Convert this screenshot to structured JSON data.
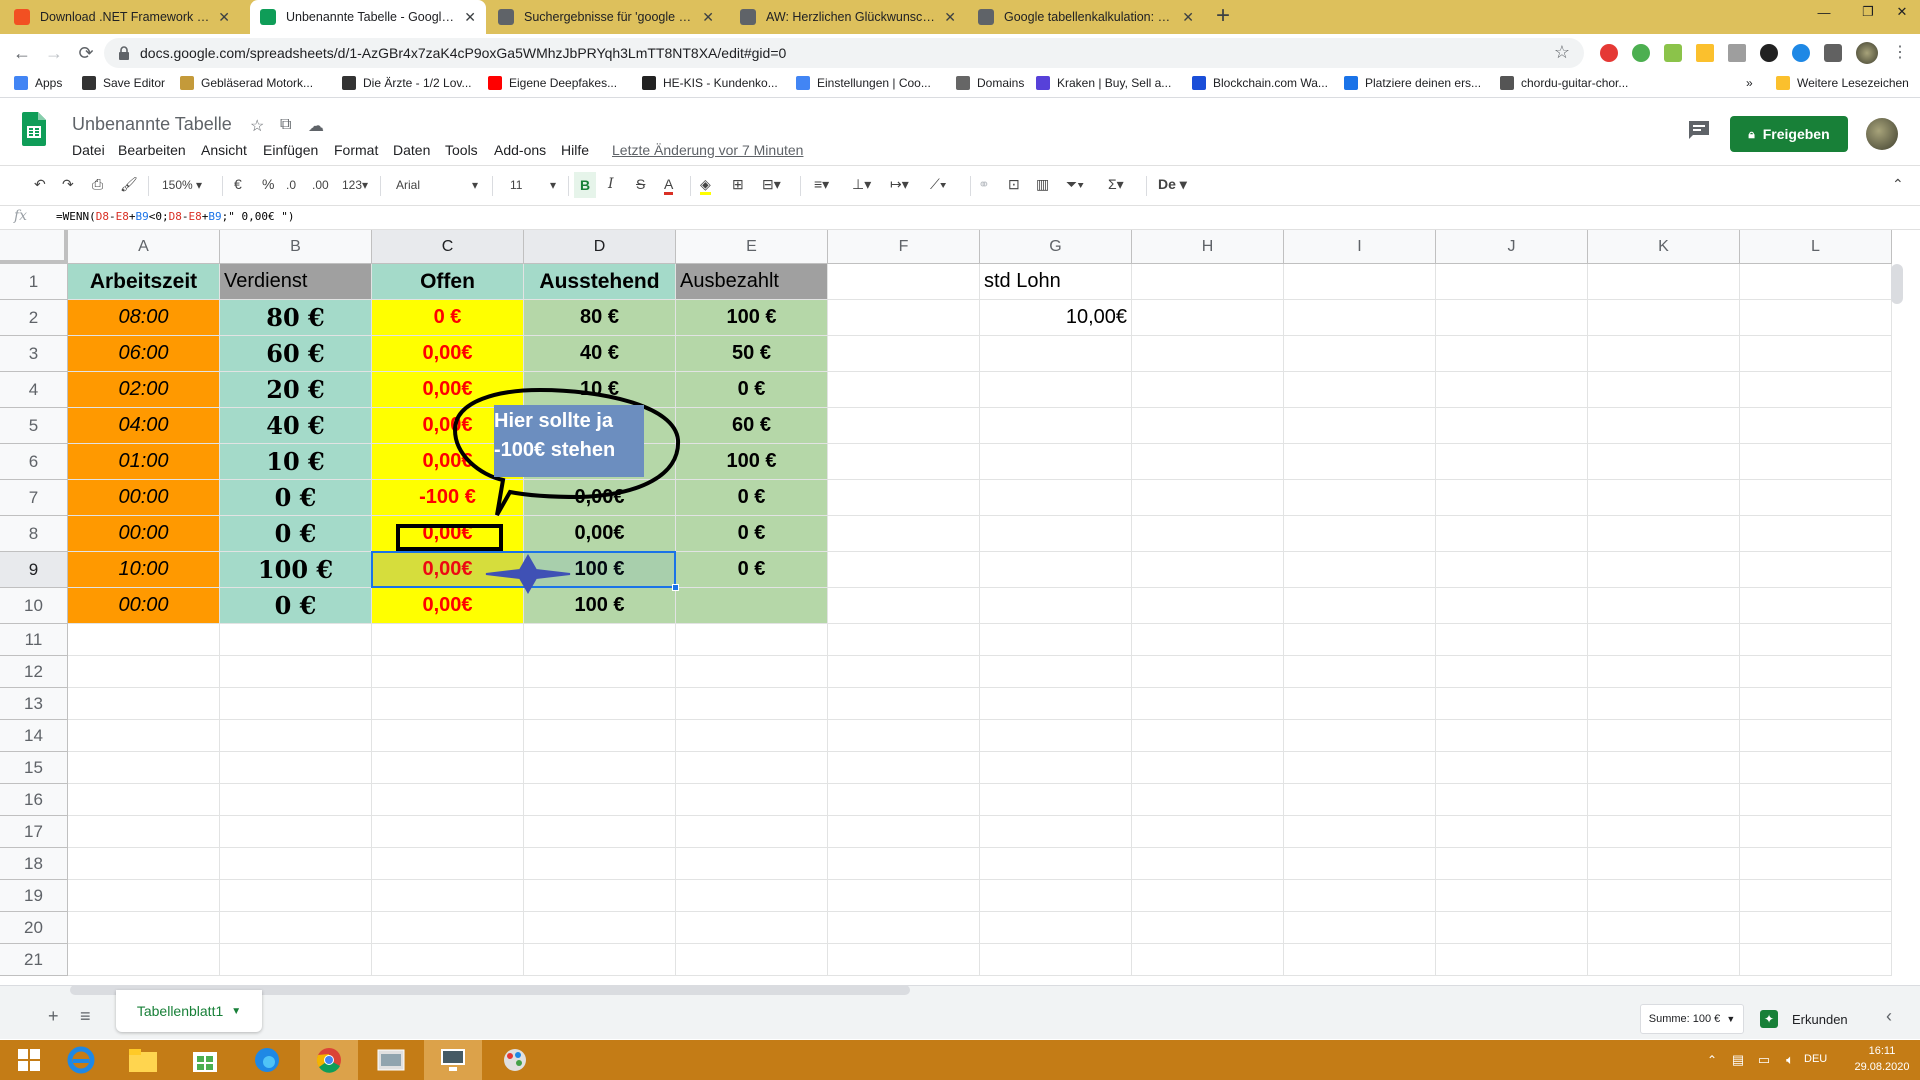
{
  "browser": {
    "tabs": [
      {
        "title": "Download .NET Framework | Free",
        "active": false,
        "favicon_color": "#f25022"
      },
      {
        "title": "Unbenannte Tabelle - Google Ta",
        "active": true,
        "favicon_color": "#0f9d58"
      },
      {
        "title": "Suchergebnisse für 'google tabel",
        "active": false,
        "favicon_color": "#5f6368"
      },
      {
        "title": "AW: Herzlichen Glückwunsch zur",
        "active": false,
        "favicon_color": "#5f6368"
      },
      {
        "title": "Google tabellenkalkulation: Sum",
        "active": false,
        "favicon_color": "#5f6368"
      }
    ],
    "tab_close": "✕",
    "new_tab": "+",
    "url": "docs.google.com/spreadsheets/d/1-AzGBr4x7zaK4cP9oxGa5WMhzJbPRYqh3LmTT8NT8XA/edit#gid=0",
    "bookmarks": [
      {
        "label": "Apps",
        "color": "#4285f4"
      },
      {
        "label": "Save Editor",
        "color": "#333333"
      },
      {
        "label": "Gebläserad Motork...",
        "color": "#c49a3a"
      },
      {
        "label": "Die Ärzte - 1/2 Lov...",
        "color": "#333333"
      },
      {
        "label": "Eigene Deepfakes...",
        "color": "#ff0000"
      },
      {
        "label": "HE-KIS - Kundenko...",
        "color": "#222222"
      },
      {
        "label": "Einstellungen | Coo...",
        "color": "#4285f4"
      },
      {
        "label": "Domains",
        "color": "#666666"
      },
      {
        "label": "Kraken | Buy, Sell a...",
        "color": "#5741d9"
      },
      {
        "label": "Blockchain.com Wa...",
        "color": "#1a4ed8"
      },
      {
        "label": "Platziere deinen ers...",
        "color": "#1a73e8"
      },
      {
        "label": "chordu-guitar-chor...",
        "color": "#555555"
      }
    ],
    "bookmarks_more": "»",
    "other_bookmarks": "Weitere Lesezeichen"
  },
  "sheets": {
    "title": "Unbenannte Tabelle",
    "menu": [
      "Datei",
      "Bearbeiten",
      "Ansicht",
      "Einfügen",
      "Format",
      "Daten",
      "Tools",
      "Add-ons",
      "Hilfe"
    ],
    "last_edit": "Letzte Änderung vor 7 Minuten",
    "share_label": "Freigeben",
    "toolbar": {
      "zoom": "150%",
      "currency": "€",
      "percent": "%",
      "dec_less": ".0",
      "dec_more": ".00",
      "format_more": "123",
      "font": "Arial",
      "font_size": "11",
      "bold": "B",
      "italic": "I",
      "strike": "S",
      "text_color": "A",
      "sigma": "Σ",
      "input_tool": "De"
    },
    "formula_label": "fx",
    "formula": {
      "p1": "=WENN(",
      "p2": "D8",
      "p3": "-",
      "p4": "E8",
      "p5": "+",
      "p6": "B9",
      "p7": "<0;",
      "p8": "D8",
      "p9": "-",
      "p10": "E8",
      "p11": "+",
      "p12": "B9",
      "p13": ";\" 0,00€ \")"
    },
    "columns": [
      "A",
      "B",
      "C",
      "D",
      "E",
      "F",
      "G",
      "H",
      "I",
      "J",
      "K",
      "L"
    ],
    "rows": [
      "1",
      "2",
      "3",
      "4",
      "5",
      "6",
      "7",
      "8",
      "9",
      "10",
      "11",
      "12",
      "13",
      "14",
      "15",
      "16",
      "17",
      "18",
      "19",
      "20",
      "21"
    ],
    "headers": {
      "A": "Arbeitszeit",
      "B": "Verdienst",
      "C": "Offen",
      "D": "Ausstehend",
      "E": "Ausbezahlt",
      "G": "std Lohn"
    },
    "data": [
      {
        "A": "08:00",
        "B": "80 €",
        "C": "0 €",
        "D": "80 €",
        "E": "100 €",
        "G": "10,00€"
      },
      {
        "A": "06:00",
        "B": "60 €",
        "C": "0,00€",
        "D": "40 €",
        "E": "50 €",
        "G": ""
      },
      {
        "A": "02:00",
        "B": "20 €",
        "C": "0,00€",
        "D": "10 €",
        "E": "0 €",
        "G": ""
      },
      {
        "A": "04:00",
        "B": "40 €",
        "C": "0,00€",
        "D": "",
        "E": "60 €",
        "G": ""
      },
      {
        "A": "01:00",
        "B": "10 €",
        "C": "0,00€",
        "D": "",
        "E": "100 €",
        "G": ""
      },
      {
        "A": "00:00",
        "B": "0 €",
        "C": "-100 €",
        "D": "0,00€",
        "E": "0 €",
        "G": ""
      },
      {
        "A": "00:00",
        "B": "0 €",
        "C": "0,00€",
        "D": "0,00€",
        "E": "0 €",
        "G": ""
      },
      {
        "A": "10:00",
        "B": "100 €",
        "C": "0,00€",
        "D": "100 €",
        "E": "0 €",
        "G": ""
      },
      {
        "A": "00:00",
        "B": "0 €",
        "C": "0,00€",
        "D": "100 €",
        "E": "",
        "G": ""
      }
    ],
    "callout_line1": "Hier sollte ja",
    "callout_line2": "-100€ stehen",
    "sheet_tab": "Tabellenblatt1",
    "sum_label": "Summe: 100 €",
    "explore_label": "Erkunden",
    "colors": {
      "accent": "#188038",
      "orange": "#ff9900",
      "teal": "#a4dac9",
      "yellow": "#ffff00",
      "green": "#b5d7a8",
      "selection": "#1a73e8"
    }
  },
  "taskbar": {
    "lang": "DEU",
    "time": "16:11",
    "date": "29.08.2020"
  }
}
